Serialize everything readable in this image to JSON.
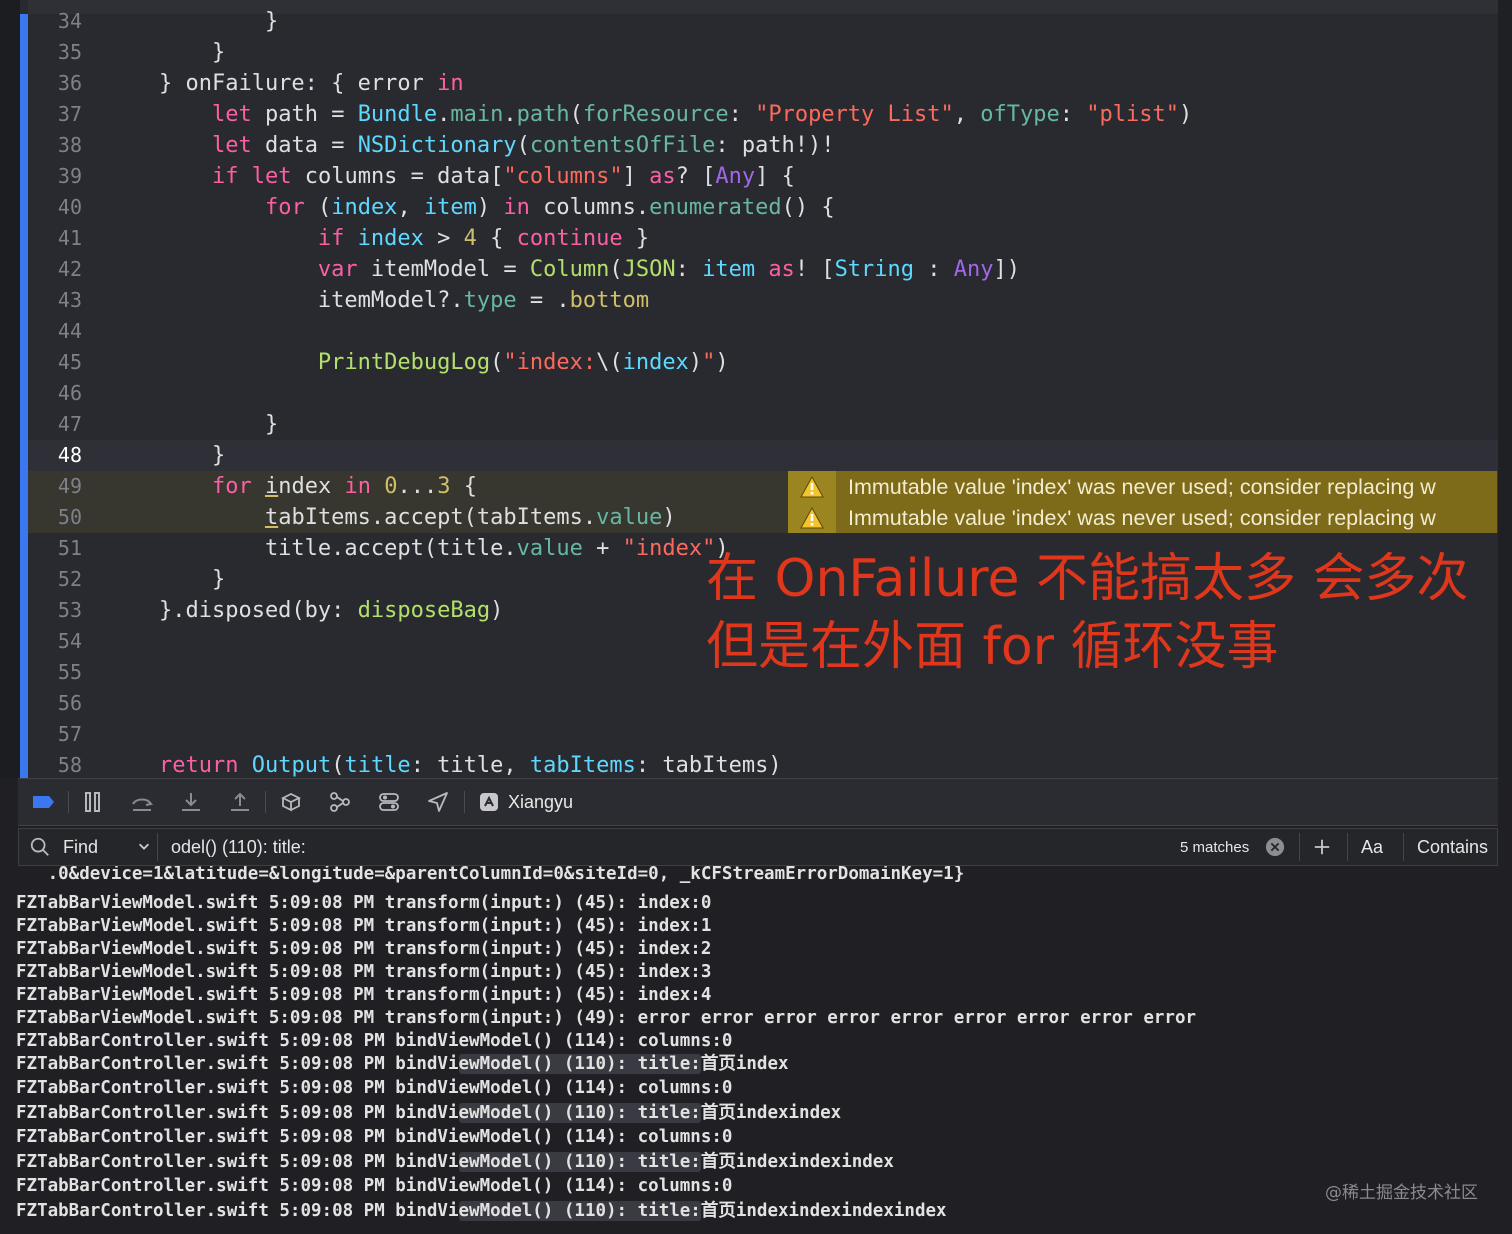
{
  "editor": {
    "lines": [
      {
        "n": "34",
        "cls": "",
        "segs": [
          [
            "            }",
            ""
          ]
        ]
      },
      {
        "n": "35",
        "cls": "",
        "segs": [
          [
            "        }",
            ""
          ]
        ]
      },
      {
        "n": "36",
        "cls": "",
        "segs": [
          [
            "    } onFailure: { error ",
            ""
          ],
          [
            "in",
            "t-kw"
          ]
        ]
      },
      {
        "n": "37",
        "cls": "",
        "segs": [
          [
            "        ",
            ""
          ],
          [
            "let",
            "t-kw"
          ],
          [
            " path = ",
            ""
          ],
          [
            "Bundle",
            "t-ty"
          ],
          [
            ".",
            ""
          ],
          [
            "main",
            "t-me"
          ],
          [
            ".",
            ""
          ],
          [
            "path",
            "t-me"
          ],
          [
            "(",
            ""
          ],
          [
            "forResource",
            "t-me"
          ],
          [
            ": ",
            ""
          ],
          [
            "\"Property List\"",
            "t-st"
          ],
          [
            ", ",
            ""
          ],
          [
            "ofType",
            "t-me"
          ],
          [
            ": ",
            ""
          ],
          [
            "\"plist\"",
            "t-st"
          ],
          [
            ")",
            ""
          ]
        ]
      },
      {
        "n": "38",
        "cls": "",
        "segs": [
          [
            "        ",
            ""
          ],
          [
            "let",
            "t-kw"
          ],
          [
            " data = ",
            ""
          ],
          [
            "NSDictionary",
            "t-ty"
          ],
          [
            "(",
            ""
          ],
          [
            "contentsOfFile",
            "t-me"
          ],
          [
            ": path!)!",
            ""
          ]
        ]
      },
      {
        "n": "39",
        "cls": "",
        "segs": [
          [
            "        ",
            ""
          ],
          [
            "if",
            "t-kw"
          ],
          [
            " ",
            ""
          ],
          [
            "let",
            "t-kw"
          ],
          [
            " columns = data[",
            ""
          ],
          [
            "\"columns\"",
            "t-st"
          ],
          [
            "] ",
            ""
          ],
          [
            "as",
            "t-kw"
          ],
          [
            "? [",
            ""
          ],
          [
            "Any",
            "t-pr"
          ],
          [
            "] {",
            ""
          ]
        ]
      },
      {
        "n": "40",
        "cls": "",
        "segs": [
          [
            "            ",
            ""
          ],
          [
            "for",
            "t-kw"
          ],
          [
            " (",
            ""
          ],
          [
            "index",
            "t-ty"
          ],
          [
            ", ",
            ""
          ],
          [
            "item",
            "t-ty"
          ],
          [
            ") ",
            ""
          ],
          [
            "in",
            "t-kw"
          ],
          [
            " columns.",
            ""
          ],
          [
            "enumerated",
            "t-me"
          ],
          [
            "() {",
            ""
          ]
        ]
      },
      {
        "n": "41",
        "cls": "",
        "segs": [
          [
            "                ",
            ""
          ],
          [
            "if",
            "t-kw"
          ],
          [
            " ",
            ""
          ],
          [
            "index",
            "t-ty"
          ],
          [
            " > ",
            ""
          ],
          [
            "4",
            "t-nu"
          ],
          [
            " { ",
            ""
          ],
          [
            "continue",
            "t-kw"
          ],
          [
            " }",
            ""
          ]
        ]
      },
      {
        "n": "42",
        "cls": "",
        "segs": [
          [
            "                ",
            ""
          ],
          [
            "var",
            "t-kw"
          ],
          [
            " itemModel = ",
            ""
          ],
          [
            "Column",
            "t-gr"
          ],
          [
            "(",
            ""
          ],
          [
            "JSON",
            "t-gr"
          ],
          [
            ": ",
            ""
          ],
          [
            "item",
            "t-ty"
          ],
          [
            " ",
            ""
          ],
          [
            "as",
            "t-kw"
          ],
          [
            "! [",
            ""
          ],
          [
            "String",
            "t-ty"
          ],
          [
            " : ",
            ""
          ],
          [
            "Any",
            "t-pr"
          ],
          [
            "])",
            ""
          ]
        ]
      },
      {
        "n": "43",
        "cls": "",
        "segs": [
          [
            "                itemModel?.",
            ""
          ],
          [
            "type",
            "t-me"
          ],
          [
            " = .",
            ""
          ],
          [
            "bottom",
            "t-nu"
          ]
        ]
      },
      {
        "n": "44",
        "cls": "",
        "segs": [
          [
            "",
            ""
          ]
        ]
      },
      {
        "n": "45",
        "cls": "",
        "segs": [
          [
            "                ",
            ""
          ],
          [
            "PrintDebugLog",
            "t-gr"
          ],
          [
            "(",
            ""
          ],
          [
            "\"index:",
            "t-st"
          ],
          [
            "\\(",
            ""
          ],
          [
            "index",
            "t-ty"
          ],
          [
            ")",
            ""
          ],
          [
            "\"",
            "t-st"
          ],
          [
            ")",
            ""
          ]
        ]
      },
      {
        "n": "46",
        "cls": "",
        "segs": [
          [
            "",
            ""
          ]
        ]
      },
      {
        "n": "47",
        "cls": "",
        "segs": [
          [
            "            }",
            ""
          ]
        ]
      },
      {
        "n": "48",
        "cls": "cur",
        "segs": [
          [
            "        }",
            ""
          ]
        ]
      },
      {
        "n": "49",
        "cls": "warn",
        "segs": [
          [
            "        ",
            ""
          ],
          [
            "for",
            "t-kw"
          ],
          [
            " ",
            ""
          ],
          [
            "i",
            "t-ul"
          ],
          [
            "ndex ",
            ""
          ],
          [
            "in",
            "t-kw"
          ],
          [
            " ",
            ""
          ],
          [
            "0",
            "t-nu"
          ],
          [
            "...",
            ""
          ],
          [
            "3",
            "t-nu"
          ],
          [
            " {",
            ""
          ]
        ]
      },
      {
        "n": "50",
        "cls": "warn",
        "segs": [
          [
            "            ",
            ""
          ],
          [
            "t",
            "t-ul"
          ],
          [
            "abItems.accept(tabItems.",
            ""
          ],
          [
            "value",
            "t-me"
          ],
          [
            ")",
            ""
          ]
        ]
      },
      {
        "n": "51",
        "cls": "",
        "segs": [
          [
            "            title.accept(title.",
            ""
          ],
          [
            "value",
            "t-me"
          ],
          [
            " + ",
            ""
          ],
          [
            "\"index\"",
            "t-st"
          ],
          [
            ")",
            ""
          ]
        ]
      },
      {
        "n": "52",
        "cls": "",
        "segs": [
          [
            "        }",
            ""
          ]
        ]
      },
      {
        "n": "53",
        "cls": "",
        "segs": [
          [
            "    }.disposed(by: ",
            ""
          ],
          [
            "disposeBag",
            "t-gr"
          ],
          [
            ")",
            ""
          ]
        ]
      },
      {
        "n": "54",
        "cls": "",
        "segs": [
          [
            "",
            ""
          ]
        ]
      },
      {
        "n": "55",
        "cls": "",
        "segs": [
          [
            "",
            ""
          ]
        ]
      },
      {
        "n": "56",
        "cls": "",
        "segs": [
          [
            "",
            ""
          ]
        ]
      },
      {
        "n": "57",
        "cls": "",
        "segs": [
          [
            "",
            ""
          ]
        ]
      },
      {
        "n": "58",
        "cls": "",
        "segs": [
          [
            "    ",
            ""
          ],
          [
            "return",
            "t-kw"
          ],
          [
            " ",
            ""
          ],
          [
            "Output",
            "t-ty"
          ],
          [
            "(",
            ""
          ],
          [
            "title",
            "t-ty"
          ],
          [
            ": title, ",
            ""
          ],
          [
            "tabItems",
            "t-ty"
          ],
          [
            ": tabItems)",
            ""
          ]
        ]
      }
    ],
    "warnings": [
      {
        "line_index": 15,
        "text": "Immutable value 'index' was never used; consider replacing w"
      },
      {
        "line_index": 16,
        "text": "Immutable value 'index' was never used; consider replacing w"
      }
    ],
    "annotation": {
      "line1": "在 OnFailure 不能搞太多 会多次",
      "line2": "但是在外面 for 循环没事"
    }
  },
  "debug_bar": {
    "process_name": "Xiangyu",
    "icons": [
      "breakpoints-toggle-icon",
      "pause-icon",
      "step-over-icon",
      "step-into-icon",
      "step-out-icon",
      "view-hierarchy-icon",
      "memory-graph-icon",
      "environment-overrides-icon",
      "location-icon",
      "app-icon"
    ]
  },
  "find_bar": {
    "mode": "Find",
    "query": "odel() (110): title:",
    "matches": "5 matches",
    "case_label": "Aa",
    "match_mode": "Contains"
  },
  "console": {
    "lines": [
      {
        "pre": "   .0&device=1&latitude=&longitude=&parentColumnId=0&siteId=0, _kCFStreamErrorDomainKey=1}",
        "hl": "",
        "post": ""
      },
      {
        "pre": "FZTabBarViewModel.swift 5:09:08 PM transform(input:) (45): index:0",
        "hl": "",
        "post": ""
      },
      {
        "pre": "FZTabBarViewModel.swift 5:09:08 PM transform(input:) (45): index:1",
        "hl": "",
        "post": ""
      },
      {
        "pre": "FZTabBarViewModel.swift 5:09:08 PM transform(input:) (45): index:2",
        "hl": "",
        "post": ""
      },
      {
        "pre": "FZTabBarViewModel.swift 5:09:08 PM transform(input:) (45): index:3",
        "hl": "",
        "post": ""
      },
      {
        "pre": "FZTabBarViewModel.swift 5:09:08 PM transform(input:) (45): index:4",
        "hl": "",
        "post": ""
      },
      {
        "pre": "FZTabBarViewModel.swift 5:09:08 PM transform(input:) (49): error error error error error error error error error",
        "hl": "",
        "post": ""
      },
      {
        "pre": "FZTabBarController.swift 5:09:08 PM bindViewModel() (114): columns:0",
        "hl": "",
        "post": ""
      },
      {
        "pre": "FZTabBarController.swift 5:09:08 PM bindVi",
        "hl": "ewModel() (110): title:",
        "post": "首页index"
      },
      {
        "pre": "FZTabBarController.swift 5:09:08 PM bindViewModel() (114): columns:0",
        "hl": "",
        "post": ""
      },
      {
        "pre": "FZTabBarController.swift 5:09:08 PM bindVi",
        "hl": "ewModel() (110): title:",
        "post": "首页indexindex"
      },
      {
        "pre": "FZTabBarController.swift 5:09:08 PM bindViewModel() (114): columns:0",
        "hl": "",
        "post": ""
      },
      {
        "pre": "FZTabBarController.swift 5:09:08 PM bindVi",
        "hl": "ewModel() (110): title:",
        "post": "首页indexindexindex"
      },
      {
        "pre": "FZTabBarController.swift 5:09:08 PM bindViewModel() (114): columns:0",
        "hl": "",
        "post": ""
      },
      {
        "pre": "FZTabBarController.swift 5:09:08 PM bindVi",
        "hl": "ewModel() (110): title:",
        "post": "首页indexindexindexindex"
      }
    ]
  },
  "watermark": "@稀土掘金技术社区",
  "colors": {
    "accent": "#3a78f0",
    "warning": "#7e6b19",
    "annotation": "#e0361b"
  }
}
